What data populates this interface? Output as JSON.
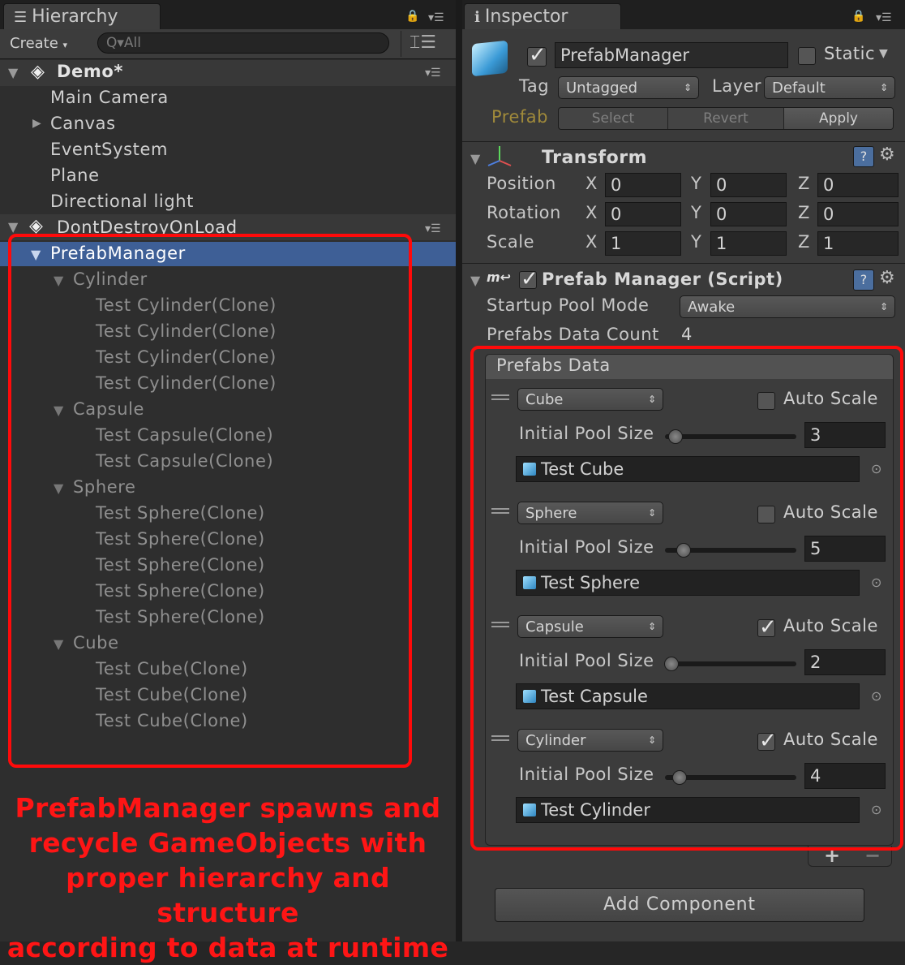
{
  "hierarchy": {
    "tab_label": "Hierarchy",
    "create_label": "Create",
    "search_placeholder": "Q▾All",
    "scenes": [
      {
        "name": "Demo*",
        "items": [
          "Main Camera",
          "Canvas",
          "EventSystem",
          "Plane",
          "Directional light"
        ]
      },
      {
        "name": "DontDestroyOnLoad"
      }
    ],
    "prefab_manager": "PrefabManager",
    "groups": [
      {
        "name": "Cylinder",
        "children": [
          "Test Cylinder(Clone)",
          "Test Cylinder(Clone)",
          "Test Cylinder(Clone)",
          "Test Cylinder(Clone)"
        ]
      },
      {
        "name": "Capsule",
        "children": [
          "Test Capsule(Clone)",
          "Test Capsule(Clone)"
        ]
      },
      {
        "name": "Sphere",
        "children": [
          "Test Sphere(Clone)",
          "Test Sphere(Clone)",
          "Test Sphere(Clone)",
          "Test Sphere(Clone)",
          "Test Sphere(Clone)"
        ]
      },
      {
        "name": "Cube",
        "children": [
          "Test Cube(Clone)",
          "Test Cube(Clone)",
          "Test Cube(Clone)"
        ]
      }
    ],
    "annotation": [
      "PrefabManager spawns and",
      "recycle GameObjects with",
      "proper hierarchy and structure",
      "according to data at runtime"
    ]
  },
  "inspector": {
    "tab_label": "Inspector",
    "object_name": "PrefabManager",
    "static_label": "Static",
    "tag_label": "Tag",
    "tag_value": "Untagged",
    "layer_label": "Layer",
    "layer_value": "Default",
    "prefab_label": "Prefab",
    "prefab_buttons": [
      "Select",
      "Revert",
      "Apply"
    ],
    "transform": {
      "title": "Transform",
      "rows": [
        {
          "label": "Position",
          "x": "0",
          "y": "0",
          "z": "0"
        },
        {
          "label": "Rotation",
          "x": "0",
          "y": "0",
          "z": "0"
        },
        {
          "label": "Scale",
          "x": "1",
          "y": "1",
          "z": "1"
        }
      ],
      "axis_labels": [
        "X",
        "Y",
        "Z"
      ]
    },
    "script": {
      "title": "Prefab Manager (Script)",
      "startup_label": "Startup Pool Mode",
      "startup_value": "Awake",
      "count_label": "Prefabs Data Count",
      "count_value": "4",
      "list_title": "Prefabs Data",
      "auto_scale_label": "Auto Scale",
      "pool_size_label": "Initial Pool Size",
      "entries": [
        {
          "type": "Cube",
          "auto_scale": false,
          "pool_size": "3",
          "slider_fraction": 0.08,
          "prefab": "Test Cube"
        },
        {
          "type": "Sphere",
          "auto_scale": false,
          "pool_size": "5",
          "slider_fraction": 0.14,
          "prefab": "Test Sphere"
        },
        {
          "type": "Capsule",
          "auto_scale": true,
          "pool_size": "2",
          "slider_fraction": 0.05,
          "prefab": "Test Capsule"
        },
        {
          "type": "Cylinder",
          "auto_scale": true,
          "pool_size": "4",
          "slider_fraction": 0.11,
          "prefab": "Test Cylinder"
        }
      ],
      "plus": "+",
      "minus": "−"
    },
    "add_component_label": "Add Component"
  },
  "colors": {
    "selection": "#3e5f96",
    "annotation_red": "#ff1515",
    "prefab_gold": "#a08a3a"
  }
}
